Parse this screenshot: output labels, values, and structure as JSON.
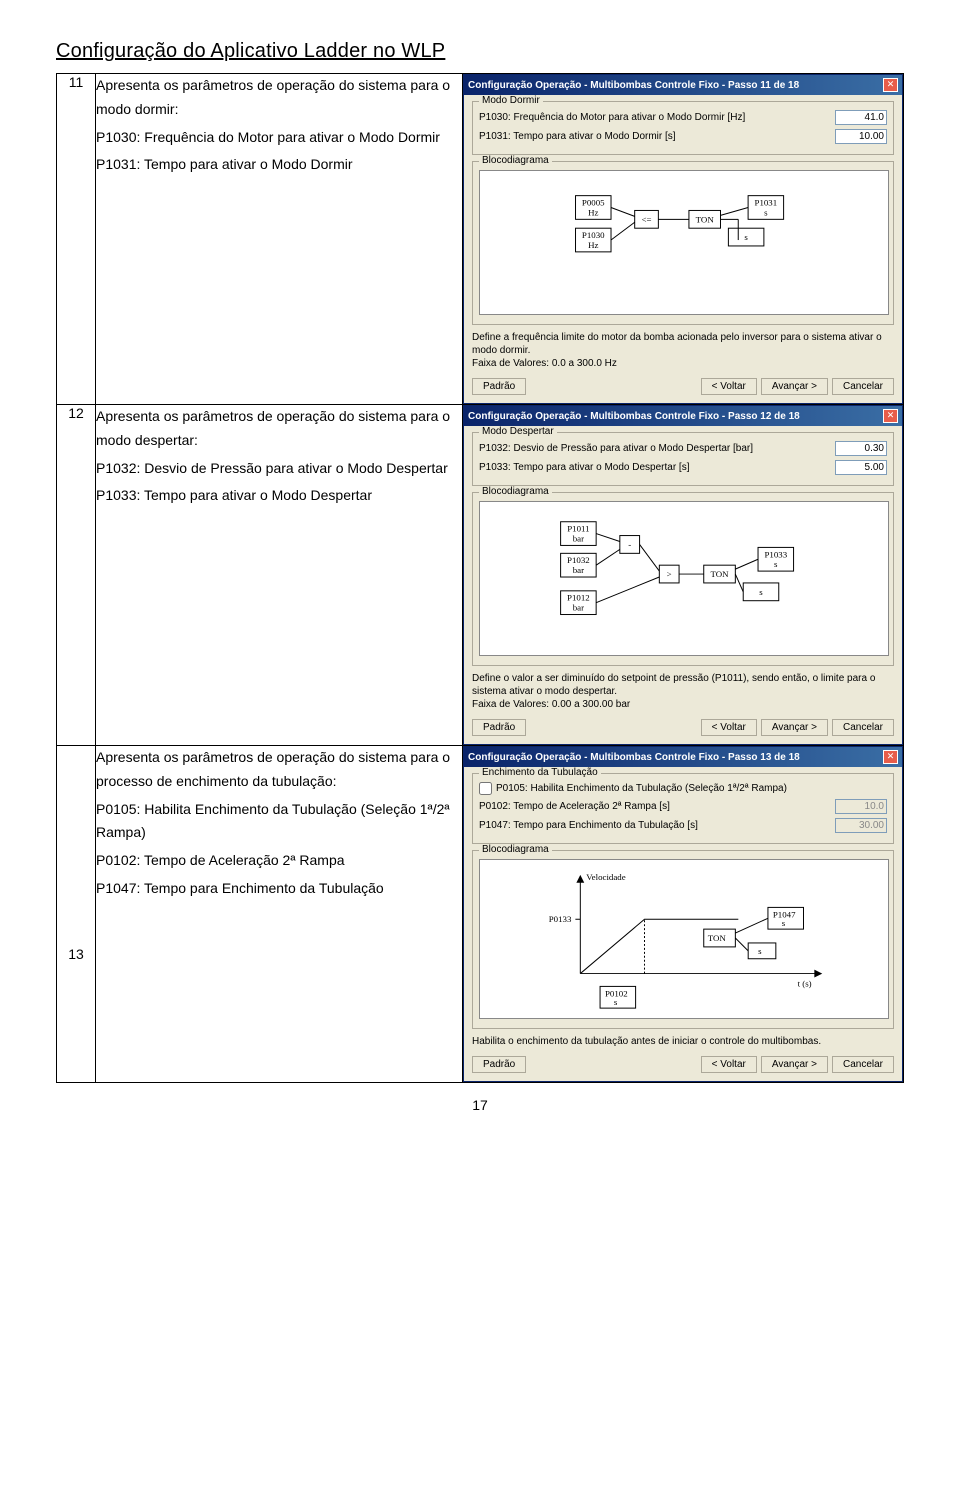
{
  "page_title": "Configuração do Aplicativo Ladder no WLP",
  "page_number": "17",
  "buttons": {
    "padrao": "Padrão",
    "voltar": "< Voltar",
    "avancar": "Avançar >",
    "cancelar": "Cancelar"
  },
  "rows": [
    {
      "num": "11",
      "desc": {
        "intro": "Apresenta os parâmetros de operação do sistema para o modo dormir:",
        "lines": [
          "P1030: Frequência do Motor para ativar o Modo Dormir",
          "P1031: Tempo para ativar o Modo Dormir"
        ]
      },
      "dialog": {
        "title": "Configuração Operação - Multibombas Controle Fixo - Passo 11 de 18",
        "group_label": "Modo Dormir",
        "params": [
          {
            "label": "P1030: Frequência do Motor para ativar o Modo Dormir [Hz]",
            "value": "41.0"
          },
          {
            "label": "P1031: Tempo para ativar o Modo Dormir [s]",
            "value": "10.00"
          }
        ],
        "bloco_label": "Blocodiagrama",
        "help1": "Define a frequência limite do motor da bomba acionada pelo inversor para o sistema ativar o modo dormir.",
        "help2": "Faixa de Valores: 0.0 a 300.0 Hz",
        "diagram": {
          "b1": "P0005\nHz",
          "b2": "P1030\nHz",
          "b3": "P1031\ns",
          "b4": "s",
          "op": "<=",
          "ton": "TON"
        }
      }
    },
    {
      "num": "12",
      "desc": {
        "intro": "Apresenta os parâmetros de operação do sistema para o modo despertar:",
        "lines": [
          "P1032: Desvio de Pressão para ativar o Modo Despertar",
          "P1033: Tempo para ativar o Modo Despertar"
        ]
      },
      "dialog": {
        "title": "Configuração Operação - Multibombas Controle Fixo - Passo 12 de 18",
        "group_label": "Modo Despertar",
        "params": [
          {
            "label": "P1032: Desvio de Pressão para ativar o Modo Despertar [bar]",
            "value": "0.30"
          },
          {
            "label": "P1033: Tempo para ativar o Modo Despertar [s]",
            "value": "5.00"
          }
        ],
        "bloco_label": "Blocodiagrama",
        "help1": "Define o valor a ser diminuído do setpoint de pressão (P1011), sendo então, o limite para o sistema ativar o modo despertar.",
        "help2": "Faixa de Valores: 0.00 a 300.00 bar",
        "diagram": {
          "b1": "P1011\nbar",
          "b2": "P1032\nbar",
          "b3": "P1012\nbar",
          "b4": "P1033\ns",
          "b5": "s",
          "op1": "-",
          "op2": ">",
          "ton": "TON"
        }
      }
    },
    {
      "num": "13",
      "desc": {
        "intro": "Apresenta os parâmetros de operação do sistema para o processo de enchimento da tubulação:",
        "lines": [
          "P0105: Habilita Enchimento da Tubulação (Seleção 1ª/2ª Rampa)",
          "P0102: Tempo de Aceleração 2ª Rampa",
          "P1047: Tempo para Enchimento da Tubulação"
        ]
      },
      "dialog": {
        "title": "Configuração Operação - Multibombas Controle Fixo - Passo 13 de 18",
        "group_label": "Enchimento da Tubulação",
        "chk_label": "P0105: Habilita Enchimento da Tubulação (Seleção 1ª/2ª Rampa)",
        "params": [
          {
            "label": "P0102: Tempo de Aceleração 2ª Rampa [s]",
            "value": "10.0",
            "disabled": true
          },
          {
            "label": "P1047: Tempo para Enchimento da Tubulação [s]",
            "value": "30.00",
            "disabled": true
          }
        ],
        "bloco_label": "Blocodiagrama",
        "help1": "Habilita o enchimento da tubulação antes de iniciar o controle do multibombas.",
        "help2": "",
        "diagram": {
          "ylabel": "Velocidade",
          "xlabel": "t (s)",
          "p0133": "P0133",
          "p0102": "P0102\ns",
          "p1047": "P1047\ns",
          "ton": "TON"
        }
      }
    }
  ]
}
